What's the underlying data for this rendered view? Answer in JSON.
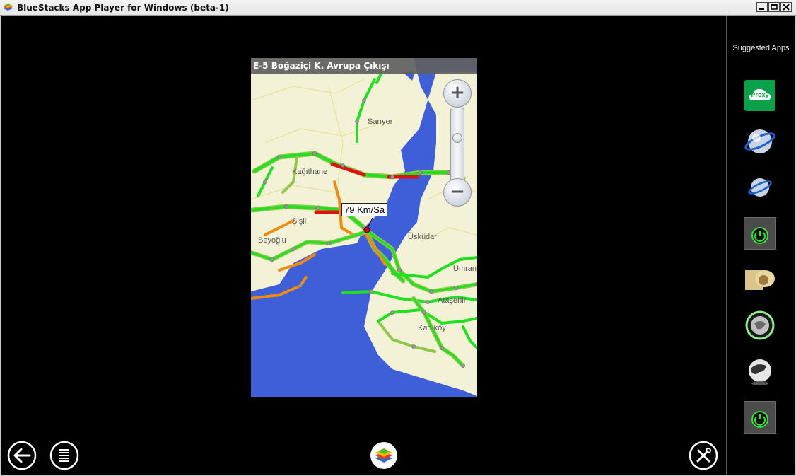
{
  "window": {
    "title": "BlueStacks App Player for Windows (beta-1)"
  },
  "map": {
    "route_label": "E-5  Boğaziçi K. Avrupa Çıkışı",
    "speed_label": "79 Km/Sa",
    "places": [
      "Sarıyer",
      "Kağıthane",
      "Şişli",
      "Beyoğlu",
      "Üsküdar",
      "Ümraniye",
      "Ataşehir",
      "Kadıköy"
    ],
    "zoom": {
      "in_symbol": "+",
      "out_symbol": "−"
    },
    "colors": {
      "water": "#3f5fd8",
      "land": "#f3f1d6",
      "free_flow": "#20e020",
      "moderate": "#f08a10",
      "congested": "#e01010"
    }
  },
  "sidebar": {
    "title": "Suggested Apps",
    "apps": [
      "proxy-app-icon",
      "planet-browser-icon",
      "planet-browser-small-icon",
      "power-app-icon",
      "gold-hands-icon",
      "green-globe-icon",
      "dark-globe-icon",
      "power-app-icon-2"
    ],
    "proxy_label": "Proxy"
  }
}
